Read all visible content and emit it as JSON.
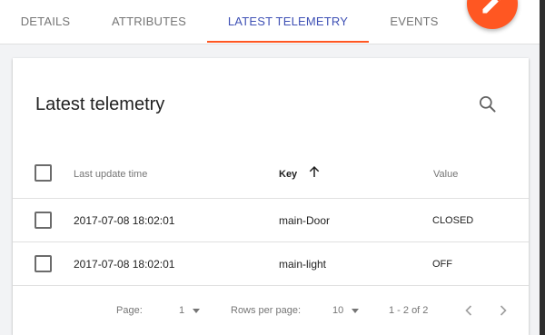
{
  "tabs": [
    {
      "label": "DETAILS"
    },
    {
      "label": "ATTRIBUTES"
    },
    {
      "label": "LATEST TELEMETRY"
    },
    {
      "label": "EVENTS"
    }
  ],
  "active_tab": "LATEST TELEMETRY",
  "card": {
    "title": "Latest telemetry"
  },
  "table": {
    "columns": {
      "last_update": "Last update time",
      "key": "Key",
      "value": "Value"
    },
    "rows": [
      {
        "time": "2017-07-08 18:02:01",
        "key": "main-Door",
        "value": "CLOSED"
      },
      {
        "time": "2017-07-08 18:02:01",
        "key": "main-light",
        "value": "OFF"
      }
    ]
  },
  "footer": {
    "page_label": "Page:",
    "page_value": "1",
    "rows_per_page_label": "Rows per page:",
    "rows_per_page_value": "10",
    "range": "1 - 2 of 2"
  },
  "colors": {
    "accent": "#ff5722",
    "active_tab_text": "#3f51b5"
  },
  "icons": {
    "fab": "pencil-icon",
    "search": "search-icon",
    "sort": "arrow-up-icon",
    "prev": "chevron-left-icon",
    "next": "chevron-right-icon"
  }
}
